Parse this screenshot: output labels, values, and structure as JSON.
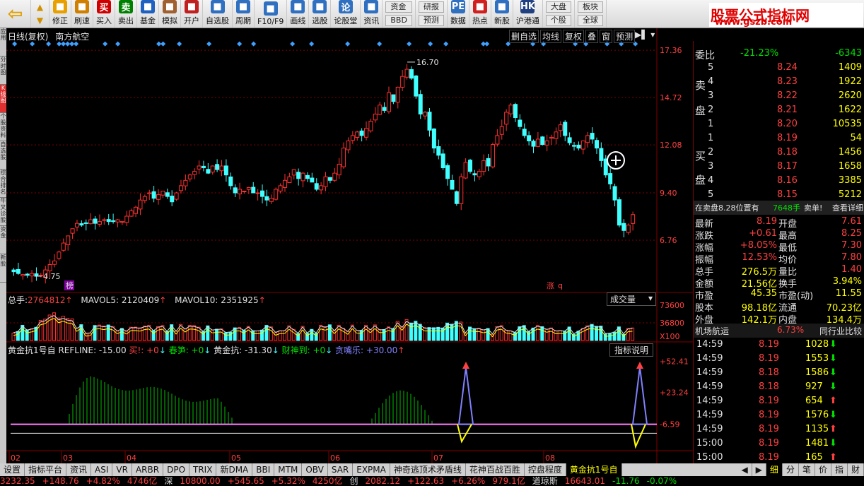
{
  "toolbar": {
    "buttons": [
      {
        "label": "修正",
        "icon": "edit-icon",
        "color": "#e8a000"
      },
      {
        "label": "刷速",
        "icon": "clock-icon",
        "color": "#d08000"
      },
      {
        "label": "买入",
        "icon": "buy-icon",
        "glyph": "买",
        "color": "#d00000"
      },
      {
        "label": "卖出",
        "icon": "sell-icon",
        "glyph": "卖",
        "color": "#008000"
      },
      {
        "label": "基金",
        "icon": "fund-icon",
        "color": "#2060c0"
      },
      {
        "label": "模拟",
        "icon": "hammer-icon",
        "color": "#a06030"
      },
      {
        "label": "开户",
        "icon": "account-icon",
        "color": "#c02020"
      },
      {
        "label": "自选股",
        "icon": "star-icon",
        "color": "#3070c0"
      },
      {
        "label": "周期",
        "icon": "cycle-icon",
        "color": "#3070c0"
      },
      {
        "label": "F10/F9",
        "icon": "f10-icon",
        "color": "#3070c0"
      },
      {
        "label": "画线",
        "icon": "pen-icon",
        "color": "#3070c0"
      },
      {
        "label": "选股",
        "icon": "select-icon",
        "color": "#3070c0"
      },
      {
        "label": "论股堂",
        "icon": "forum-icon",
        "glyph": "论",
        "color": "#3070c0"
      },
      {
        "label": "资讯",
        "icon": "news-icon",
        "color": "#3070c0"
      }
    ],
    "stack1": [
      "资金",
      "BBD"
    ],
    "stack2": [
      "研报",
      "预测"
    ],
    "buttons2": [
      {
        "label": "数据",
        "icon": "pe-icon",
        "glyph": "PE",
        "color": "#3070c0"
      },
      {
        "label": "热点",
        "icon": "hot-icon",
        "color": "#d02020"
      },
      {
        "label": "新股",
        "icon": "newstock-icon",
        "color": "#3070c0"
      },
      {
        "label": "沪港通",
        "icon": "hk-icon",
        "glyph": "HK",
        "color": "#204080"
      }
    ],
    "stack3": [
      "大盘",
      "个股"
    ],
    "stack4": [
      "板块",
      "全球"
    ]
  },
  "brand": {
    "title": "股票公式指标网",
    "url": "www.gszb.com"
  },
  "lefttabs": [
    "应用",
    "分时图",
    "K线图",
    "个股资料",
    "自选股",
    "综合排名",
    "牛叉诊股",
    "资金",
    "新股"
  ],
  "chart": {
    "title": "日线(复权)",
    "stock": "南方航空",
    "buttons": [
      "删自选",
      "均线",
      "复权",
      "叠",
      "窗",
      "预测"
    ],
    "price_labels": [
      "17.36",
      "14.72",
      "12.08",
      "9.40",
      "6.76"
    ],
    "high_label": "16.70",
    "low_label": "4.75",
    "marker_bang": "榜",
    "marker_zhang": "涨",
    "vol_legend": {
      "total_label": "总手:",
      "total": "2764812",
      "ma5_label": "MAVOL5:",
      "ma5": "2120409",
      "ma10_label": "MAVOL10:",
      "ma10": "2351925"
    },
    "vol_panel_name": "成交量",
    "vol_labels": [
      "73600",
      "36800",
      "X100"
    ],
    "ind_legend": {
      "name": "黄金抗1号自",
      "refline": "REFLINE: -15.00",
      "buy": "买!: +0",
      "spring": "春笋: +0",
      "gold": "黄金抗: -31.30",
      "wealth": "财神到: +0",
      "greedy": "贪嘴乐: +30.00"
    },
    "ind_help": "指标说明",
    "ind_labels": [
      "+52.41",
      "+23.24",
      "-6.59"
    ],
    "x_labels": [
      "02",
      "03",
      "04",
      "05",
      "06",
      "07",
      "08"
    ]
  },
  "chart_data": {
    "type": "candlestick",
    "title": "日线(复权)",
    "ylim": [
      4.0,
      17.8
    ],
    "price_ticks": [
      17.36,
      14.72,
      12.08,
      9.4,
      6.76
    ],
    "closes": [
      5.0,
      4.9,
      4.85,
      4.8,
      4.9,
      4.75,
      4.8,
      5.1,
      5.4,
      5.6,
      6.1,
      6.6,
      7.0,
      7.4,
      7.7,
      7.6,
      7.7,
      7.9,
      7.7,
      7.8,
      7.9,
      7.8,
      7.8,
      7.9,
      7.8,
      8.1,
      8.4,
      8.6,
      9.0,
      9.2,
      9.4,
      9.1,
      9.3,
      9.5,
      9.2,
      8.9,
      9.4,
      9.8,
      10.1,
      10.4,
      10.6,
      10.9,
      10.8,
      10.5,
      10.9,
      10.7,
      10.9,
      10.4,
      9.8,
      9.4,
      9.6,
      9.5,
      9.7,
      9.4,
      9.4,
      9.2,
      9.0,
      9.1,
      9.6,
      9.8,
      10.1,
      10.3,
      10.7,
      10.2,
      10.5,
      10.2,
      10.0,
      9.6,
      9.8,
      10.3,
      10.1,
      10.5,
      11.0,
      11.9,
      12.3,
      12.6,
      12.8,
      12.6,
      13.0,
      13.4,
      13.8,
      14.3,
      14.0,
      15.0,
      14.5,
      15.3,
      15.9,
      16.3,
      15.8,
      14.8,
      13.8,
      13.9,
      12.9,
      11.9,
      11.5,
      10.8,
      10.2,
      9.6,
      8.8,
      10.3,
      11.1,
      10.6,
      10.4,
      10.6,
      11.2,
      10.9,
      12.1,
      12.6,
      13.1,
      13.9,
      14.3,
      13.6,
      13.1,
      12.6,
      12.3,
      12.0,
      12.4,
      12.1,
      12.3,
      12.5,
      12.8,
      13.2,
      12.6,
      12.2,
      12.0,
      11.9,
      12.3,
      12.6,
      12.4,
      11.9,
      11.2,
      10.4,
      9.9,
      9.0,
      7.6,
      7.3,
      7.6,
      8.19
    ],
    "volume_ylim": [
      0,
      73600
    ],
    "volume_ticks": [
      73600,
      36800
    ],
    "indicator_ylim": [
      -30,
      60
    ],
    "indicator_ticks": [
      52.41,
      23.24,
      -6.59
    ],
    "indicator_refline": -15.0,
    "x_labels": [
      "02",
      "03",
      "04",
      "05",
      "06",
      "07",
      "08"
    ]
  },
  "quote": {
    "weibi_label": "委比",
    "weibi_pct": "-21.23%",
    "weibi_val": "-6343",
    "sell_label": [
      "卖",
      "盘"
    ],
    "buy_label": [
      "买",
      "盘"
    ],
    "asks": [
      {
        "n": "5",
        "p": "8.24",
        "v": "1409"
      },
      {
        "n": "4",
        "p": "8.23",
        "v": "1922"
      },
      {
        "n": "3",
        "p": "8.22",
        "v": "2620"
      },
      {
        "n": "2",
        "p": "8.21",
        "v": "1622"
      },
      {
        "n": "1",
        "p": "8.20",
        "v": "10535"
      }
    ],
    "bids": [
      {
        "n": "1",
        "p": "8.19",
        "v": "54"
      },
      {
        "n": "2",
        "p": "8.18",
        "v": "1456"
      },
      {
        "n": "3",
        "p": "8.17",
        "v": "1658"
      },
      {
        "n": "4",
        "p": "8.16",
        "v": "3385"
      },
      {
        "n": "5",
        "p": "8.15",
        "v": "5212"
      }
    ],
    "ask_info": "在卖盘8.28位置有",
    "ask_info_vol": "7648手",
    "ask_info_tag": "卖单!",
    "ask_info_link": "查看详细",
    "stats": [
      [
        "最新",
        "8.19",
        "开盘",
        "7.61"
      ],
      [
        "涨跌",
        "+0.61",
        "最高",
        "8.25"
      ],
      [
        "涨幅",
        "+8.05%",
        "最低",
        "7.30"
      ],
      [
        "振幅",
        "12.53%",
        "均价",
        "7.80"
      ],
      [
        "总手",
        "276.5万",
        "量比",
        "1.40"
      ],
      [
        "金额",
        "21.56亿",
        "换手",
        "3.94%"
      ],
      [
        "市盈",
        "45.35",
        "市盈(动)",
        "11.55"
      ],
      [
        "股本",
        "98.18亿",
        "流通",
        "70.23亿"
      ],
      [
        "外盘",
        "142.1万",
        "内盘",
        "134.4万"
      ]
    ],
    "sector": "机场航运",
    "sector_pct": "6.73%",
    "sector_btn": "同行业比较",
    "ticks": [
      {
        "t": "14:59",
        "p": "8.19",
        "v": "1028",
        "d": "down"
      },
      {
        "t": "14:59",
        "p": "8.19",
        "v": "1553",
        "d": "down"
      },
      {
        "t": "14:59",
        "p": "8.18",
        "v": "1586",
        "d": "down"
      },
      {
        "t": "14:59",
        "p": "8.18",
        "v": "927",
        "d": "down"
      },
      {
        "t": "14:59",
        "p": "8.19",
        "v": "654",
        "d": "up"
      },
      {
        "t": "14:59",
        "p": "8.19",
        "v": "1576",
        "d": "down"
      },
      {
        "t": "14:59",
        "p": "8.19",
        "v": "1135",
        "d": "up"
      },
      {
        "t": "15:00",
        "p": "8.19",
        "v": "1481",
        "d": "down"
      },
      {
        "t": "15:00",
        "p": "8.19",
        "v": "165",
        "d": "up"
      }
    ]
  },
  "bottom_tabs": [
    "设置",
    "指标平台",
    "资讯",
    "ASI",
    "VR",
    "ARBR",
    "DPO",
    "TRIX",
    "新DMA",
    "BBI",
    "MTM",
    "OBV",
    "SAR",
    "EXPMA",
    "神奇逃顶术矛盾线",
    "花神百战百胜",
    "控盘程度",
    "黄金抗1号自"
  ],
  "bottom_active": "黄金抗1号自",
  "right_tabs": [
    "细",
    "分",
    "笔",
    "价",
    "指",
    "财"
  ],
  "statusbar": [
    "3232.35",
    "+148.76",
    "+4.82%",
    "4746亿",
    "深",
    "10800.00",
    "+545.65",
    "+5.32%",
    "4250亿",
    "创",
    "2082.12",
    "+122.63",
    "+6.26%",
    "979.1亿",
    "道琼斯",
    "16643.01",
    "-11.76",
    "-0.07%"
  ]
}
